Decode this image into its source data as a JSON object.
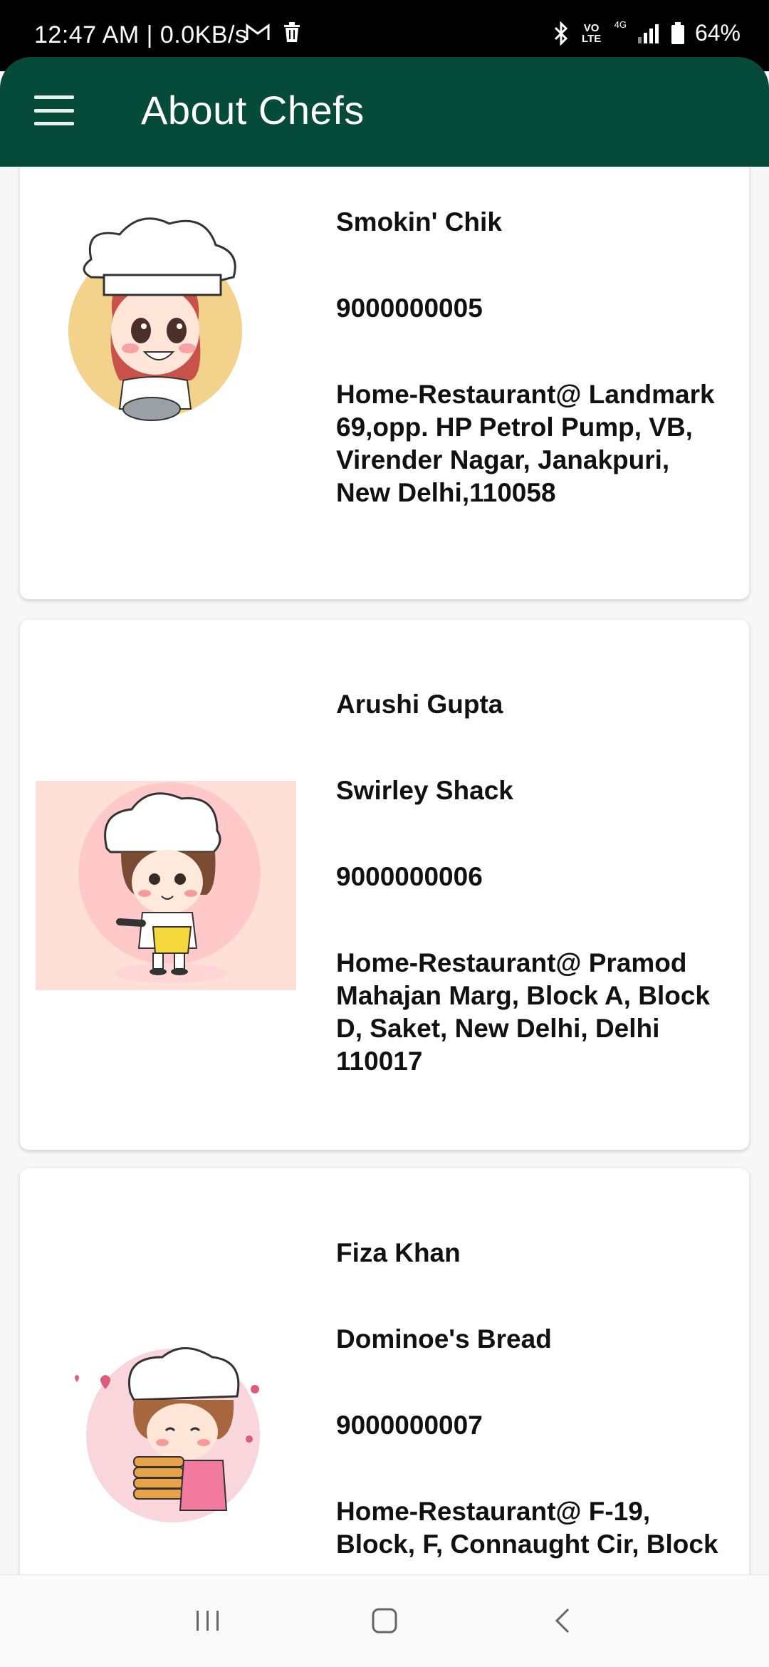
{
  "status_bar": {
    "time": "12:47 AM | 0.0KB/s",
    "network": "4G",
    "volte": "VO LTE",
    "battery": "64%"
  },
  "app_bar": {
    "title": "About Chefs"
  },
  "chefs": [
    {
      "name": "",
      "restaurant": "Smokin' Chik",
      "phone": "9000000005",
      "address": "Home-Restaurant@ Landmark 69,opp. HP Petrol Pump, VB, Virender Nagar, Janakpuri, New Delhi,110058"
    },
    {
      "name": "Arushi Gupta",
      "restaurant": "Swirley Shack",
      "phone": "9000000006",
      "address": "Home-Restaurant@ Pramod Mahajan Marg, Block A, Block D, Saket, New Delhi, Delhi 110017"
    },
    {
      "name": "Fiza Khan",
      "restaurant": "Dominoe's Bread",
      "phone": "9000000007",
      "address": "Home-Restaurant@ F-19, Block, F, Connaught Cir, Block"
    }
  ],
  "icons": {
    "menu": "hamburger-menu-icon",
    "recents": "recents-icon",
    "home": "home-icon",
    "back": "back-icon"
  },
  "colors": {
    "app_bar": "#064a3a",
    "status_bar": "#000000",
    "background": "#f7f7f7"
  }
}
